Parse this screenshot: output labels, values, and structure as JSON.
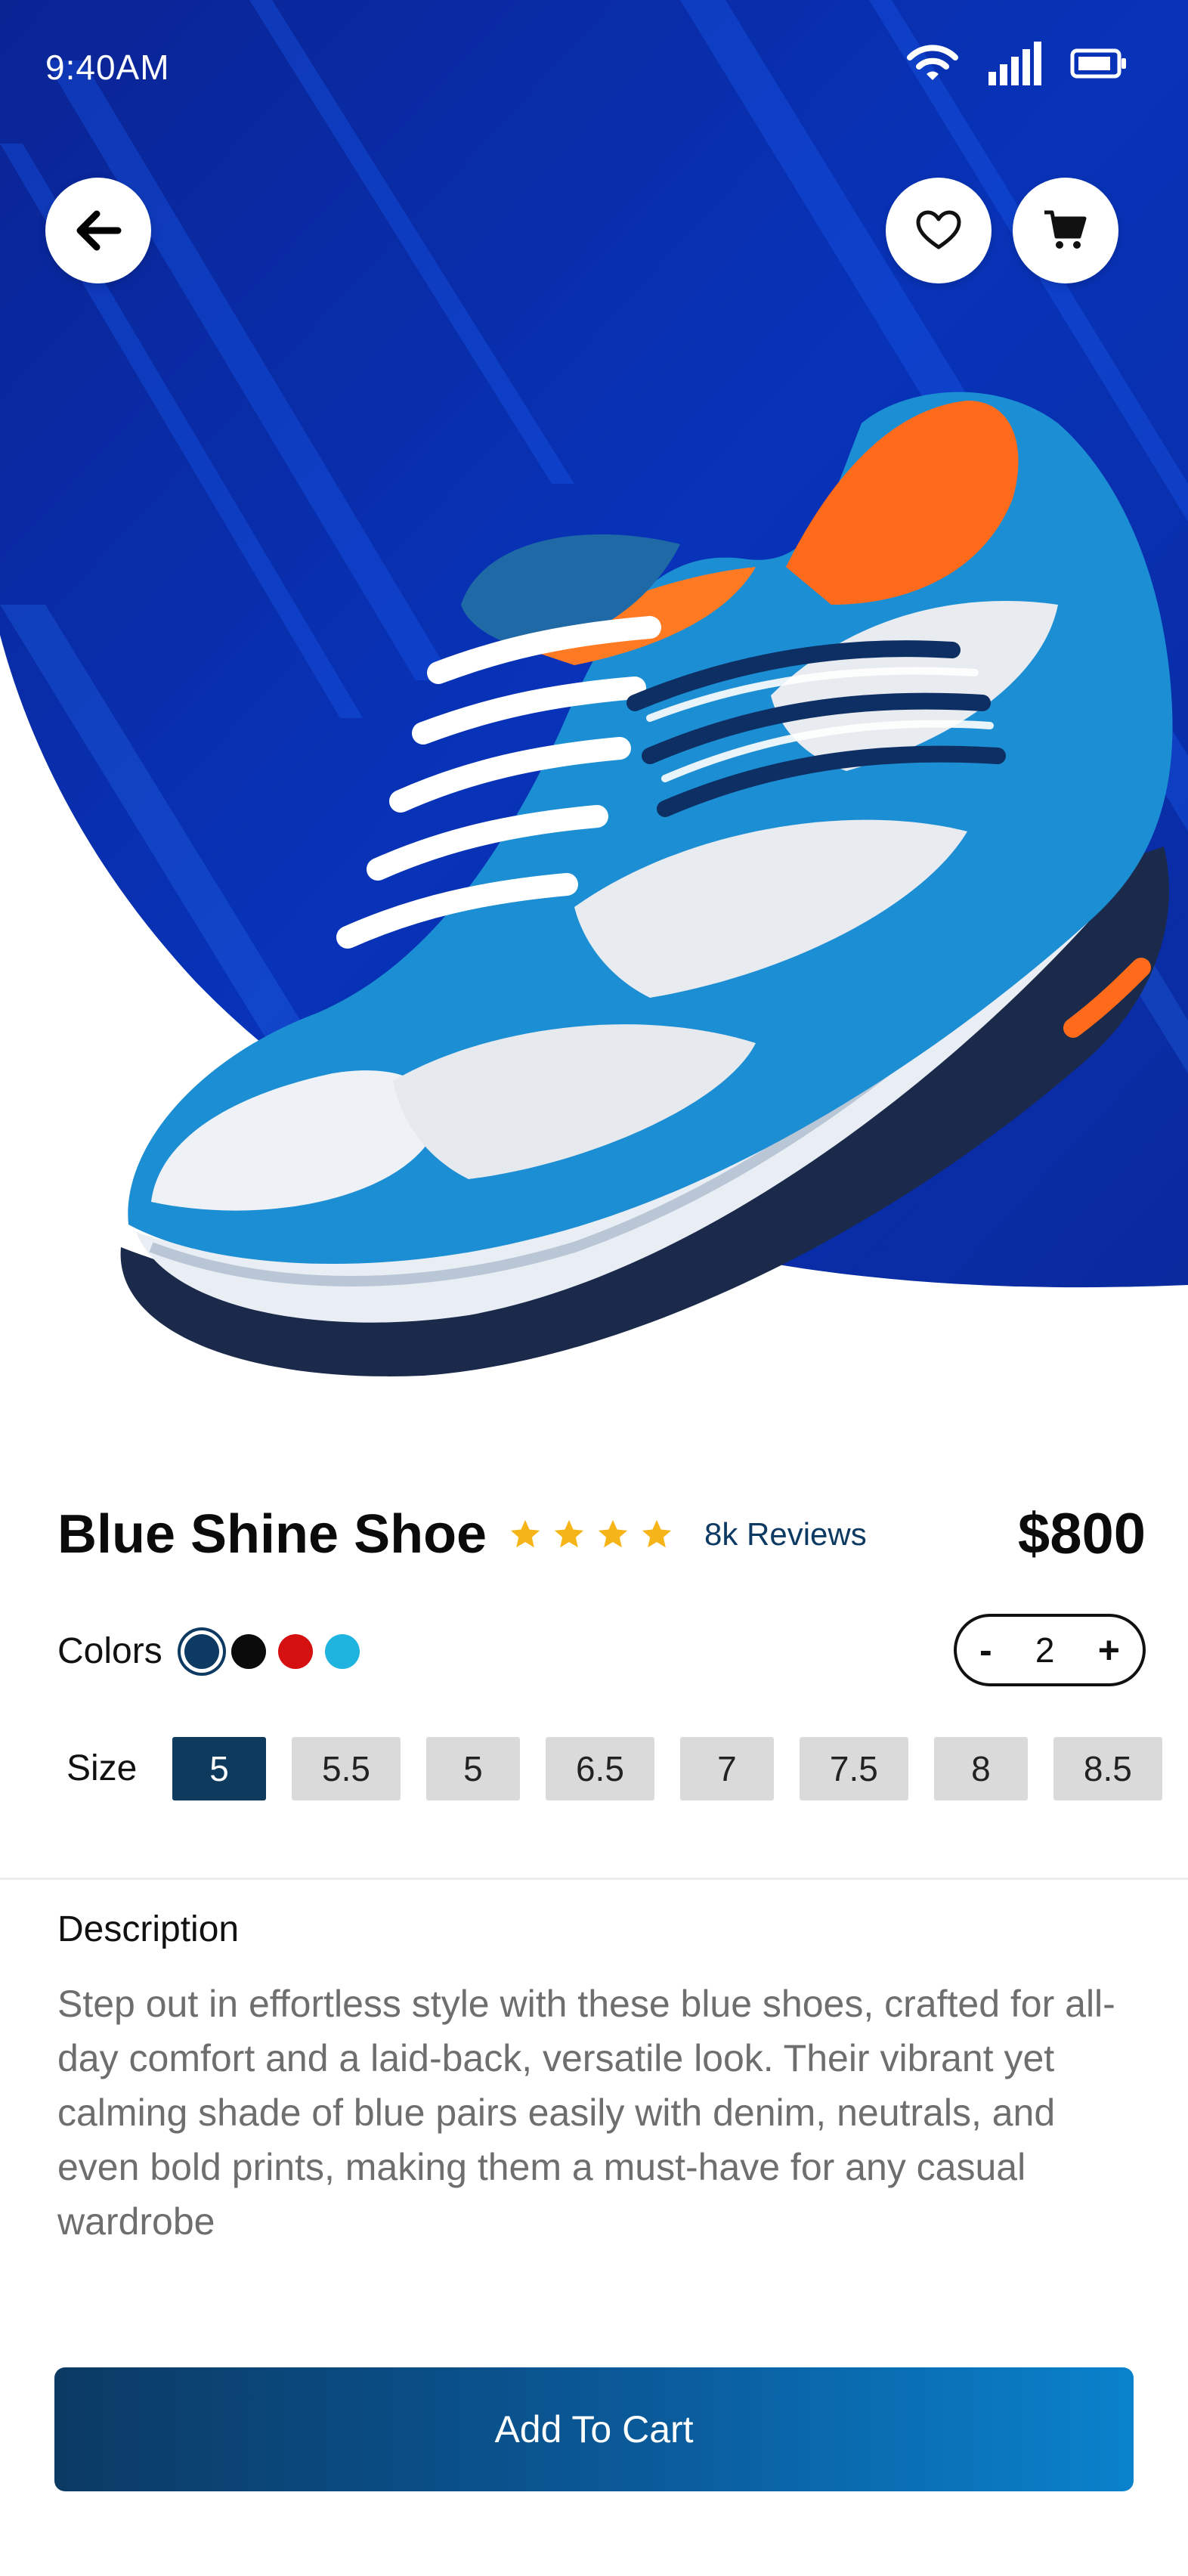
{
  "status_bar": {
    "time": "9:40AM"
  },
  "icons": {
    "back": "arrow-left-icon",
    "favorite": "heart-icon",
    "cart": "cart-icon",
    "wifi": "wifi-icon",
    "signal": "signal-icon",
    "battery": "battery-icon",
    "star": "star-icon"
  },
  "product": {
    "name": "Blue Shine Shoe",
    "rating_stars": 4,
    "reviews": "8k Reviews",
    "price": "$800",
    "colors_label": "Colors",
    "colors": [
      "#0d3a63",
      "#0b0b0b",
      "#d41010",
      "#1fb3e0"
    ],
    "selected_color_index": 0,
    "quantity": "2",
    "qty_minus": "-",
    "qty_plus": "+",
    "size_label": "Size",
    "sizes": [
      "5",
      "5.5",
      "5",
      "6.5",
      "7",
      "7.5",
      "8",
      "8.5"
    ],
    "selected_size_index": 0,
    "description_title": "Description",
    "description": "Step out in effortless style with these blue shoes, crafted for all-day comfort and a laid-back, versatile look. Their vibrant yet calming shade of blue pairs easily with denim, neutrals, and even bold prints, making them a must-have for any casual wardrobe"
  },
  "actions": {
    "add_to_cart": "Add To Cart"
  },
  "colors": {
    "hero_blue": "#0a2a9e",
    "accent_navy": "#0e3a5e",
    "star": "#f5b518"
  }
}
